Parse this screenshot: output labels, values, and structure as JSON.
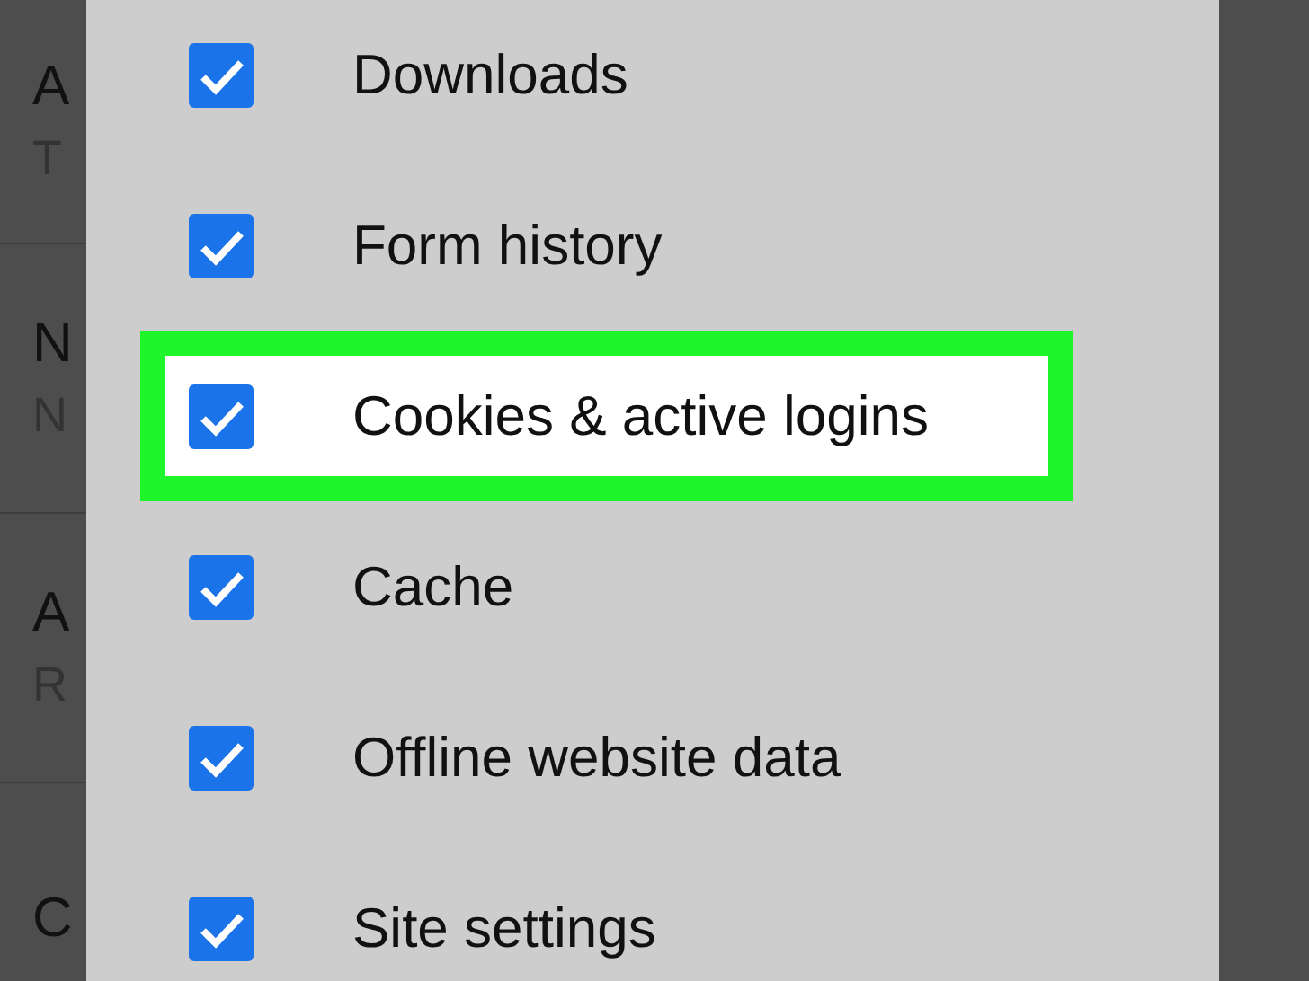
{
  "background_list": [
    {
      "title": "A",
      "subtitle": "T"
    },
    {
      "title": "N",
      "subtitle": "N"
    },
    {
      "title": "A",
      "subtitle": "R"
    },
    {
      "title": "C"
    }
  ],
  "dialog": {
    "options": [
      {
        "label": "Downloads",
        "checked": true,
        "highlighted": false
      },
      {
        "label": "Form history",
        "checked": true,
        "highlighted": false
      },
      {
        "label": "Cookies & active logins",
        "checked": true,
        "highlighted": true
      },
      {
        "label": "Cache",
        "checked": true,
        "highlighted": false
      },
      {
        "label": "Offline website data",
        "checked": true,
        "highlighted": false
      },
      {
        "label": "Site settings",
        "checked": true,
        "highlighted": false
      }
    ]
  }
}
